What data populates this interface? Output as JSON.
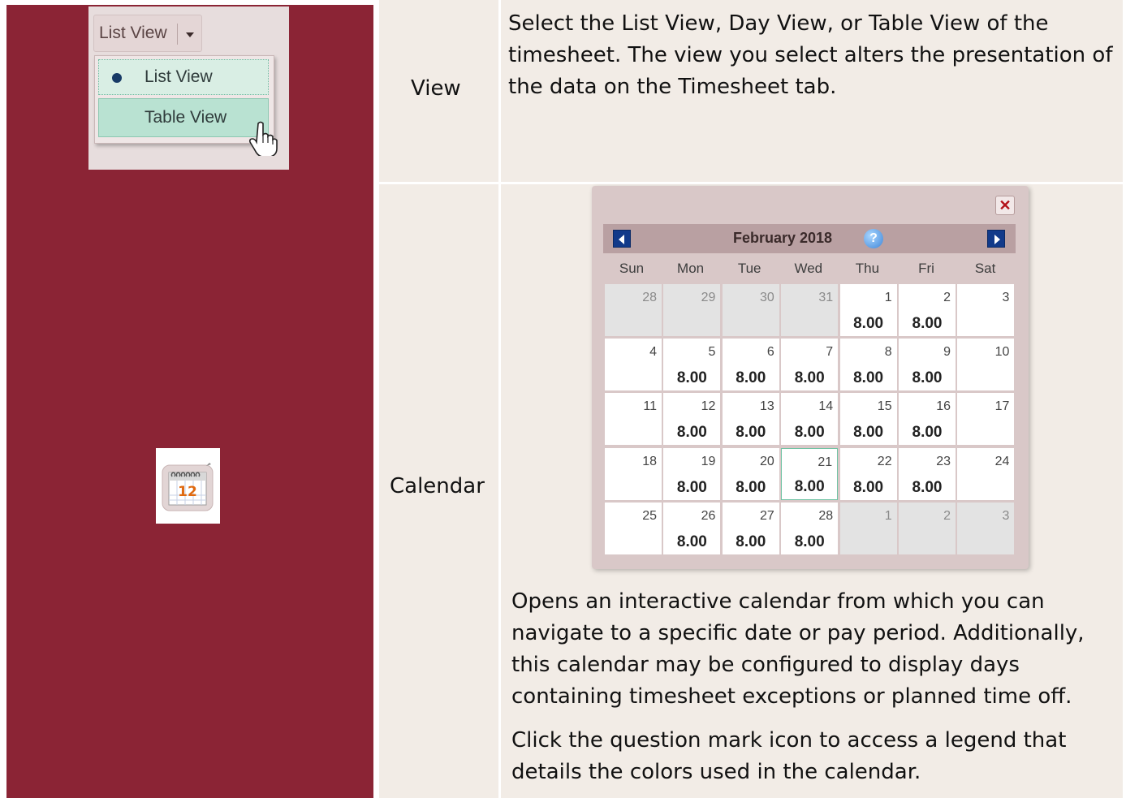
{
  "rows": [
    {
      "label": "View",
      "description": "Select the List View, Day View, or Table View of the timesheet. The view you select alters the presentation of the data on the Timesheet tab."
    },
    {
      "label": "Calendar",
      "description_1": "Opens an interactive calendar from which you can navigate to a specific date or pay period. Additionally, this calendar may be configured to display days containing timesheet exceptions or planned time off.",
      "description_2": "Click the question mark icon to access a legend that details the colors used in the calendar."
    }
  ],
  "view_dropdown": {
    "button_label": "List View",
    "items": [
      {
        "label": "List View",
        "selected": true
      },
      {
        "label": "Table View",
        "selected": false
      }
    ]
  },
  "calendar_icon": {
    "day": "12",
    "icon": "calendar-icon"
  },
  "calendar": {
    "title": "February 2018",
    "weekdays": [
      "Sun",
      "Mon",
      "Tue",
      "Wed",
      "Thu",
      "Fri",
      "Sat"
    ],
    "days": [
      {
        "n": "28",
        "h": "",
        "out": true
      },
      {
        "n": "29",
        "h": "",
        "out": true
      },
      {
        "n": "30",
        "h": "",
        "out": true
      },
      {
        "n": "31",
        "h": "",
        "out": true
      },
      {
        "n": "1",
        "h": "8.00"
      },
      {
        "n": "2",
        "h": "8.00"
      },
      {
        "n": "3",
        "h": ""
      },
      {
        "n": "4",
        "h": ""
      },
      {
        "n": "5",
        "h": "8.00"
      },
      {
        "n": "6",
        "h": "8.00"
      },
      {
        "n": "7",
        "h": "8.00"
      },
      {
        "n": "8",
        "h": "8.00"
      },
      {
        "n": "9",
        "h": "8.00"
      },
      {
        "n": "10",
        "h": ""
      },
      {
        "n": "11",
        "h": ""
      },
      {
        "n": "12",
        "h": "8.00"
      },
      {
        "n": "13",
        "h": "8.00"
      },
      {
        "n": "14",
        "h": "8.00"
      },
      {
        "n": "15",
        "h": "8.00"
      },
      {
        "n": "16",
        "h": "8.00"
      },
      {
        "n": "17",
        "h": ""
      },
      {
        "n": "18",
        "h": ""
      },
      {
        "n": "19",
        "h": "8.00"
      },
      {
        "n": "20",
        "h": "8.00"
      },
      {
        "n": "21",
        "h": "8.00",
        "sel": true
      },
      {
        "n": "22",
        "h": "8.00"
      },
      {
        "n": "23",
        "h": "8.00"
      },
      {
        "n": "24",
        "h": ""
      },
      {
        "n": "25",
        "h": ""
      },
      {
        "n": "26",
        "h": "8.00"
      },
      {
        "n": "27",
        "h": "8.00"
      },
      {
        "n": "28",
        "h": "8.00"
      },
      {
        "n": "1",
        "h": "",
        "out": true
      },
      {
        "n": "2",
        "h": "",
        "out": true
      },
      {
        "n": "3",
        "h": "",
        "out": true
      }
    ],
    "colors": {
      "header": "#b9a0a2",
      "nav": "#123a8a",
      "selected_border": "#6fc3a3"
    }
  },
  "colors": {
    "left_column": "#8b2435",
    "cell_background": "#f2ece6"
  }
}
